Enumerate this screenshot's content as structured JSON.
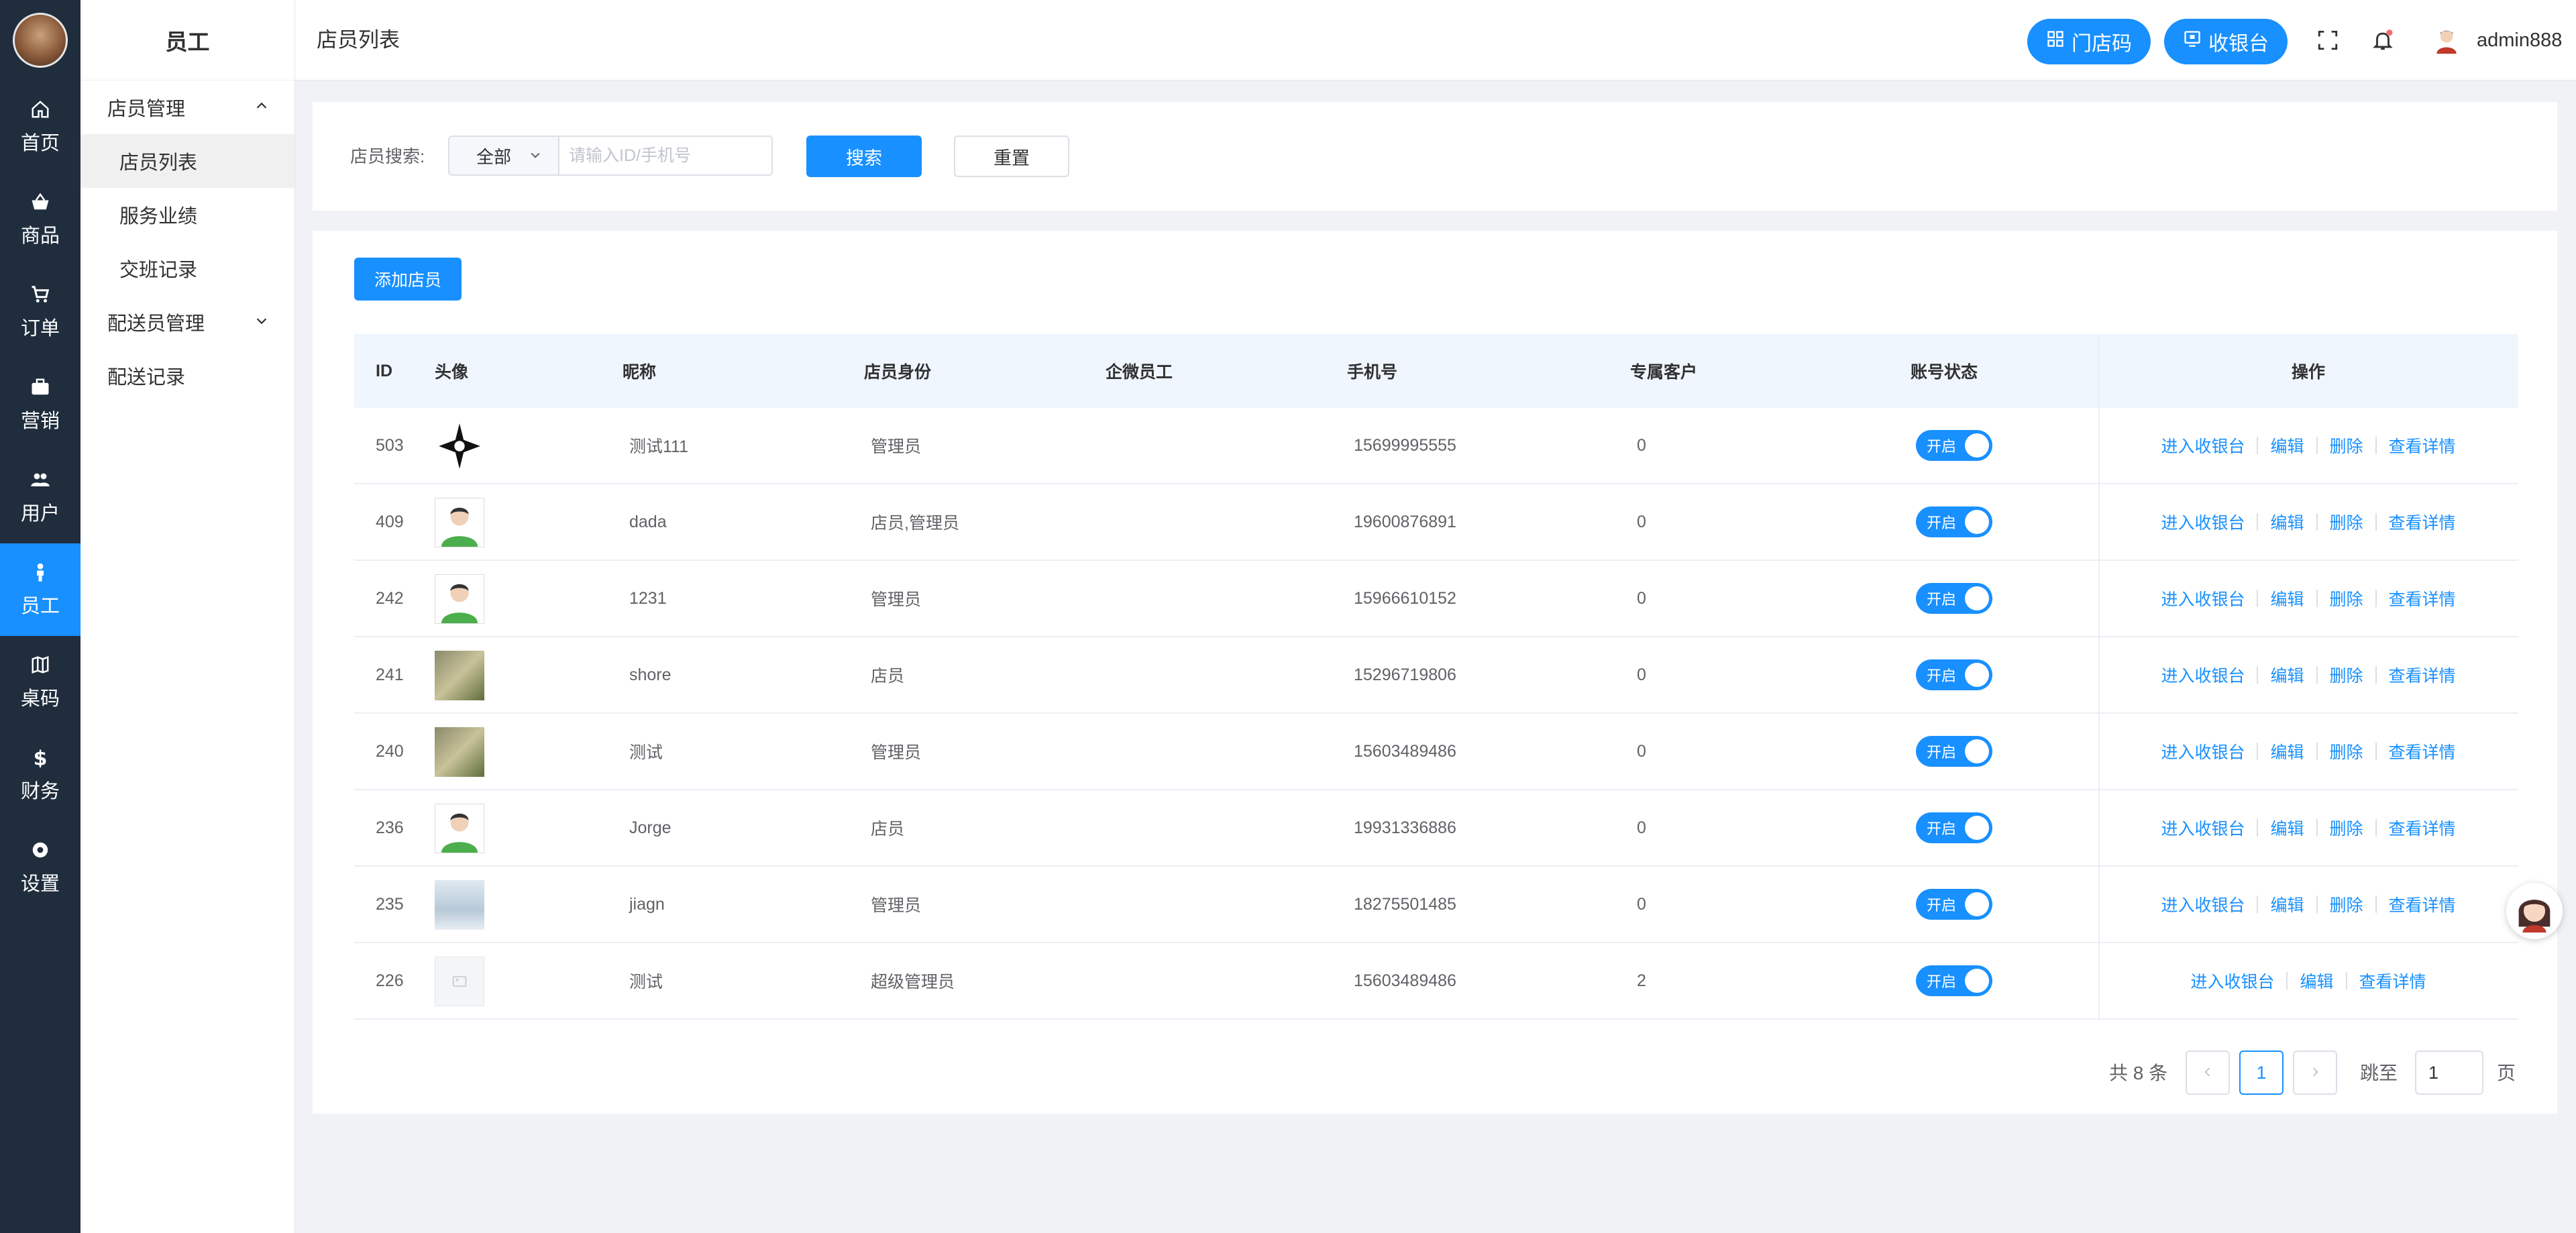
{
  "rail": {
    "items": [
      {
        "label": "首页",
        "icon": "home-icon"
      },
      {
        "label": "商品",
        "icon": "basket-icon"
      },
      {
        "label": "订单",
        "icon": "cart-icon"
      },
      {
        "label": "营销",
        "icon": "briefcase-icon"
      },
      {
        "label": "用户",
        "icon": "users-icon"
      },
      {
        "label": "员工",
        "icon": "person-icon"
      },
      {
        "label": "桌码",
        "icon": "map-icon"
      },
      {
        "label": "财务",
        "icon": "dollar-icon"
      },
      {
        "label": "设置",
        "icon": "gear-icon"
      }
    ],
    "active_index": 5,
    "active_color": "#1890ff"
  },
  "submenu": {
    "title": "员工",
    "groups": [
      {
        "label": "店员管理",
        "expanded": true,
        "items": [
          "店员列表",
          "服务业绩",
          "交班记录"
        ],
        "active_item": "店员列表"
      },
      {
        "label": "配送员管理",
        "expanded": false,
        "items": []
      }
    ],
    "extra_item": "配送记录"
  },
  "header": {
    "title": "店员列表",
    "store_code_label": "门店码",
    "cashier_label": "收银台",
    "admin_name": "admin888",
    "notification_dot_color": "#f56c6c"
  },
  "search": {
    "label": "店员搜索:",
    "select_value": "全部",
    "placeholder": "请输入ID/手机号",
    "value": "",
    "search_button": "搜索",
    "reset_button": "重置"
  },
  "actions": {
    "add_button": "添加店员"
  },
  "table": {
    "columns": [
      "ID",
      "头像",
      "昵称",
      "店员身份",
      "企微员工",
      "手机号",
      "专属客户",
      "账号状态",
      "操作"
    ],
    "rows": [
      {
        "id": "503",
        "avatar": "logo-star",
        "nickname": "测试111",
        "role": "管理员",
        "wx": "",
        "phone": "15699995555",
        "exclusive": "0",
        "status": "开启",
        "ops": [
          "进入收银台",
          "编辑",
          "删除",
          "查看详情"
        ]
      },
      {
        "id": "409",
        "avatar": "person",
        "nickname": "dada",
        "role": "店员,管理员",
        "wx": "",
        "phone": "19600876891",
        "exclusive": "0",
        "status": "开启",
        "ops": [
          "进入收银台",
          "编辑",
          "删除",
          "查看详情"
        ]
      },
      {
        "id": "242",
        "avatar": "person",
        "nickname": "1231",
        "role": "管理员",
        "wx": "",
        "phone": "15966610152",
        "exclusive": "0",
        "status": "开启",
        "ops": [
          "进入收银台",
          "编辑",
          "删除",
          "查看详情"
        ]
      },
      {
        "id": "241",
        "avatar": "food",
        "nickname": "shore",
        "role": "店员",
        "wx": "",
        "phone": "15296719806",
        "exclusive": "0",
        "status": "开启",
        "ops": [
          "进入收银台",
          "编辑",
          "删除",
          "查看详情"
        ]
      },
      {
        "id": "240",
        "avatar": "food",
        "nickname": "测试",
        "role": "管理员",
        "wx": "",
        "phone": "15603489486",
        "exclusive": "0",
        "status": "开启",
        "ops": [
          "进入收银台",
          "编辑",
          "删除",
          "查看详情"
        ]
      },
      {
        "id": "236",
        "avatar": "person",
        "nickname": "Jorge",
        "role": "店员",
        "wx": "",
        "phone": "19931336886",
        "exclusive": "0",
        "status": "开启",
        "ops": [
          "进入收银台",
          "编辑",
          "删除",
          "查看详情"
        ]
      },
      {
        "id": "235",
        "avatar": "landscape",
        "nickname": "jiagn",
        "role": "管理员",
        "wx": "",
        "phone": "18275501485",
        "exclusive": "0",
        "status": "开启",
        "ops": [
          "进入收银台",
          "编辑",
          "删除",
          "查看详情"
        ]
      },
      {
        "id": "226",
        "avatar": "blank",
        "nickname": "测试",
        "role": "超级管理员",
        "wx": "",
        "phone": "15603489486",
        "exclusive": "2",
        "status": "开启",
        "ops": [
          "进入收银台",
          "编辑",
          "查看详情"
        ]
      }
    ]
  },
  "pagination": {
    "total_text": "共 8 条",
    "current_page": "1",
    "goto_label": "跳至",
    "goto_value": "1",
    "page_unit": "页"
  },
  "colors": {
    "primary": "#1890ff",
    "rail_bg": "#1f2d3d",
    "page_bg": "#f0f2f5"
  }
}
